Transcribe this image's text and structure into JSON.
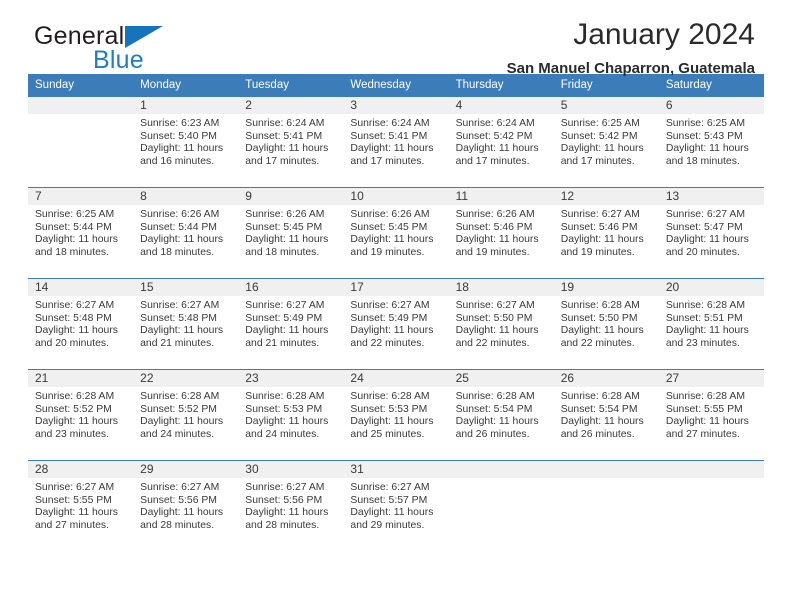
{
  "brand": {
    "name_part1": "General",
    "name_part2": "Blue",
    "accent_color": "#1574bb"
  },
  "header": {
    "title": "January 2024",
    "subtitle": "San Manuel Chaparron, Guatemala"
  },
  "calendar": {
    "header_bg": "#3c7cb8",
    "daynum_bg": "#f0f0f0",
    "weekdays": [
      "Sunday",
      "Monday",
      "Tuesday",
      "Wednesday",
      "Thursday",
      "Friday",
      "Saturday"
    ],
    "weeks": [
      [
        {
          "day": "",
          "sunrise": "",
          "sunset": "",
          "daylight1": "",
          "daylight2": ""
        },
        {
          "day": "1",
          "sunrise": "Sunrise: 6:23 AM",
          "sunset": "Sunset: 5:40 PM",
          "daylight1": "Daylight: 11 hours",
          "daylight2": "and 16 minutes."
        },
        {
          "day": "2",
          "sunrise": "Sunrise: 6:24 AM",
          "sunset": "Sunset: 5:41 PM",
          "daylight1": "Daylight: 11 hours",
          "daylight2": "and 17 minutes."
        },
        {
          "day": "3",
          "sunrise": "Sunrise: 6:24 AM",
          "sunset": "Sunset: 5:41 PM",
          "daylight1": "Daylight: 11 hours",
          "daylight2": "and 17 minutes."
        },
        {
          "day": "4",
          "sunrise": "Sunrise: 6:24 AM",
          "sunset": "Sunset: 5:42 PM",
          "daylight1": "Daylight: 11 hours",
          "daylight2": "and 17 minutes."
        },
        {
          "day": "5",
          "sunrise": "Sunrise: 6:25 AM",
          "sunset": "Sunset: 5:42 PM",
          "daylight1": "Daylight: 11 hours",
          "daylight2": "and 17 minutes."
        },
        {
          "day": "6",
          "sunrise": "Sunrise: 6:25 AM",
          "sunset": "Sunset: 5:43 PM",
          "daylight1": "Daylight: 11 hours",
          "daylight2": "and 18 minutes."
        }
      ],
      [
        {
          "day": "7",
          "sunrise": "Sunrise: 6:25 AM",
          "sunset": "Sunset: 5:44 PM",
          "daylight1": "Daylight: 11 hours",
          "daylight2": "and 18 minutes."
        },
        {
          "day": "8",
          "sunrise": "Sunrise: 6:26 AM",
          "sunset": "Sunset: 5:44 PM",
          "daylight1": "Daylight: 11 hours",
          "daylight2": "and 18 minutes."
        },
        {
          "day": "9",
          "sunrise": "Sunrise: 6:26 AM",
          "sunset": "Sunset: 5:45 PM",
          "daylight1": "Daylight: 11 hours",
          "daylight2": "and 18 minutes."
        },
        {
          "day": "10",
          "sunrise": "Sunrise: 6:26 AM",
          "sunset": "Sunset: 5:45 PM",
          "daylight1": "Daylight: 11 hours",
          "daylight2": "and 19 minutes."
        },
        {
          "day": "11",
          "sunrise": "Sunrise: 6:26 AM",
          "sunset": "Sunset: 5:46 PM",
          "daylight1": "Daylight: 11 hours",
          "daylight2": "and 19 minutes."
        },
        {
          "day": "12",
          "sunrise": "Sunrise: 6:27 AM",
          "sunset": "Sunset: 5:46 PM",
          "daylight1": "Daylight: 11 hours",
          "daylight2": "and 19 minutes."
        },
        {
          "day": "13",
          "sunrise": "Sunrise: 6:27 AM",
          "sunset": "Sunset: 5:47 PM",
          "daylight1": "Daylight: 11 hours",
          "daylight2": "and 20 minutes."
        }
      ],
      [
        {
          "day": "14",
          "sunrise": "Sunrise: 6:27 AM",
          "sunset": "Sunset: 5:48 PM",
          "daylight1": "Daylight: 11 hours",
          "daylight2": "and 20 minutes."
        },
        {
          "day": "15",
          "sunrise": "Sunrise: 6:27 AM",
          "sunset": "Sunset: 5:48 PM",
          "daylight1": "Daylight: 11 hours",
          "daylight2": "and 21 minutes."
        },
        {
          "day": "16",
          "sunrise": "Sunrise: 6:27 AM",
          "sunset": "Sunset: 5:49 PM",
          "daylight1": "Daylight: 11 hours",
          "daylight2": "and 21 minutes."
        },
        {
          "day": "17",
          "sunrise": "Sunrise: 6:27 AM",
          "sunset": "Sunset: 5:49 PM",
          "daylight1": "Daylight: 11 hours",
          "daylight2": "and 22 minutes."
        },
        {
          "day": "18",
          "sunrise": "Sunrise: 6:27 AM",
          "sunset": "Sunset: 5:50 PM",
          "daylight1": "Daylight: 11 hours",
          "daylight2": "and 22 minutes."
        },
        {
          "day": "19",
          "sunrise": "Sunrise: 6:28 AM",
          "sunset": "Sunset: 5:50 PM",
          "daylight1": "Daylight: 11 hours",
          "daylight2": "and 22 minutes."
        },
        {
          "day": "20",
          "sunrise": "Sunrise: 6:28 AM",
          "sunset": "Sunset: 5:51 PM",
          "daylight1": "Daylight: 11 hours",
          "daylight2": "and 23 minutes."
        }
      ],
      [
        {
          "day": "21",
          "sunrise": "Sunrise: 6:28 AM",
          "sunset": "Sunset: 5:52 PM",
          "daylight1": "Daylight: 11 hours",
          "daylight2": "and 23 minutes."
        },
        {
          "day": "22",
          "sunrise": "Sunrise: 6:28 AM",
          "sunset": "Sunset: 5:52 PM",
          "daylight1": "Daylight: 11 hours",
          "daylight2": "and 24 minutes."
        },
        {
          "day": "23",
          "sunrise": "Sunrise: 6:28 AM",
          "sunset": "Sunset: 5:53 PM",
          "daylight1": "Daylight: 11 hours",
          "daylight2": "and 24 minutes."
        },
        {
          "day": "24",
          "sunrise": "Sunrise: 6:28 AM",
          "sunset": "Sunset: 5:53 PM",
          "daylight1": "Daylight: 11 hours",
          "daylight2": "and 25 minutes."
        },
        {
          "day": "25",
          "sunrise": "Sunrise: 6:28 AM",
          "sunset": "Sunset: 5:54 PM",
          "daylight1": "Daylight: 11 hours",
          "daylight2": "and 26 minutes."
        },
        {
          "day": "26",
          "sunrise": "Sunrise: 6:28 AM",
          "sunset": "Sunset: 5:54 PM",
          "daylight1": "Daylight: 11 hours",
          "daylight2": "and 26 minutes."
        },
        {
          "day": "27",
          "sunrise": "Sunrise: 6:28 AM",
          "sunset": "Sunset: 5:55 PM",
          "daylight1": "Daylight: 11 hours",
          "daylight2": "and 27 minutes."
        }
      ],
      [
        {
          "day": "28",
          "sunrise": "Sunrise: 6:27 AM",
          "sunset": "Sunset: 5:55 PM",
          "daylight1": "Daylight: 11 hours",
          "daylight2": "and 27 minutes."
        },
        {
          "day": "29",
          "sunrise": "Sunrise: 6:27 AM",
          "sunset": "Sunset: 5:56 PM",
          "daylight1": "Daylight: 11 hours",
          "daylight2": "and 28 minutes."
        },
        {
          "day": "30",
          "sunrise": "Sunrise: 6:27 AM",
          "sunset": "Sunset: 5:56 PM",
          "daylight1": "Daylight: 11 hours",
          "daylight2": "and 28 minutes."
        },
        {
          "day": "31",
          "sunrise": "Sunrise: 6:27 AM",
          "sunset": "Sunset: 5:57 PM",
          "daylight1": "Daylight: 11 hours",
          "daylight2": "and 29 minutes."
        },
        {
          "day": "",
          "sunrise": "",
          "sunset": "",
          "daylight1": "",
          "daylight2": ""
        },
        {
          "day": "",
          "sunrise": "",
          "sunset": "",
          "daylight1": "",
          "daylight2": ""
        },
        {
          "day": "",
          "sunrise": "",
          "sunset": "",
          "daylight1": "",
          "daylight2": ""
        }
      ]
    ]
  }
}
